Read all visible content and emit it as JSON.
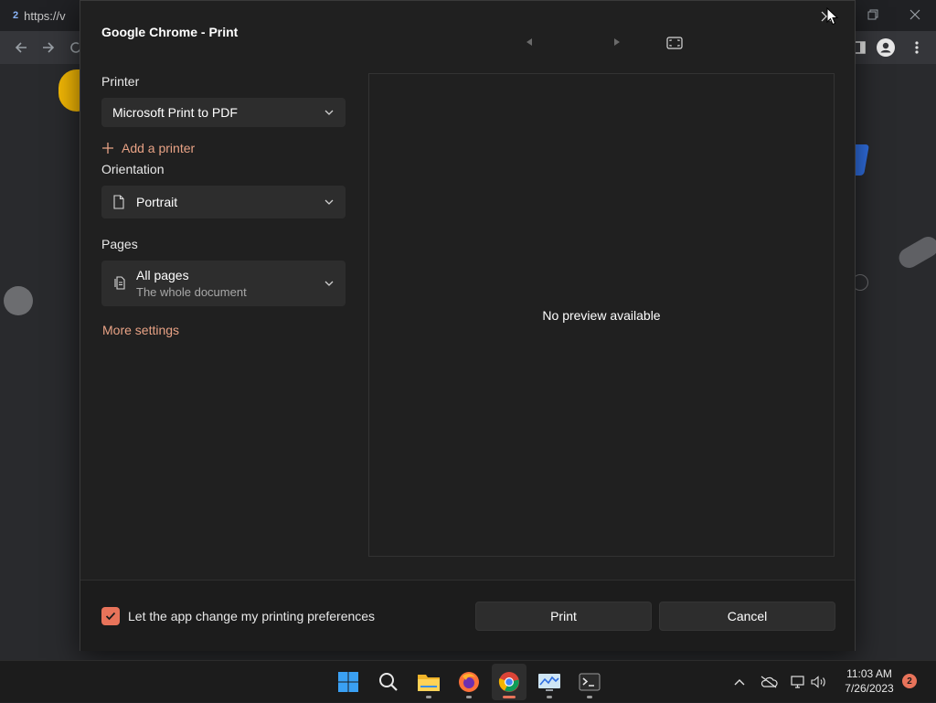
{
  "browser": {
    "tab_title": "https://v",
    "tab_favicon": "2"
  },
  "dialog": {
    "title": "Google Chrome - Print",
    "printer": {
      "label": "Printer",
      "selected": "Microsoft Print to PDF",
      "add_printer": "Add a printer"
    },
    "orientation": {
      "label": "Orientation",
      "selected": "Portrait"
    },
    "pages": {
      "label": "Pages",
      "selected": "All pages",
      "selected_sub": "The whole document"
    },
    "more_settings": "More settings",
    "preview_text": "No preview available",
    "footer": {
      "checkbox_label": "Let the app change my printing preferences",
      "checkbox_checked": true,
      "print_label": "Print",
      "cancel_label": "Cancel"
    }
  },
  "taskbar": {
    "apps": [
      {
        "name": "start-icon"
      },
      {
        "name": "search-icon"
      },
      {
        "name": "file-explorer-icon"
      },
      {
        "name": "firefox-icon"
      },
      {
        "name": "chrome-icon",
        "active": true
      },
      {
        "name": "system-monitor-icon"
      },
      {
        "name": "terminal-icon"
      }
    ],
    "time": "11:03 AM",
    "date": "7/26/2023",
    "notification_count": "2"
  },
  "colors": {
    "accent": "#e8735a",
    "link": "#e8a285",
    "dialog_bg": "#202020",
    "control_bg": "#2d2d2d"
  }
}
